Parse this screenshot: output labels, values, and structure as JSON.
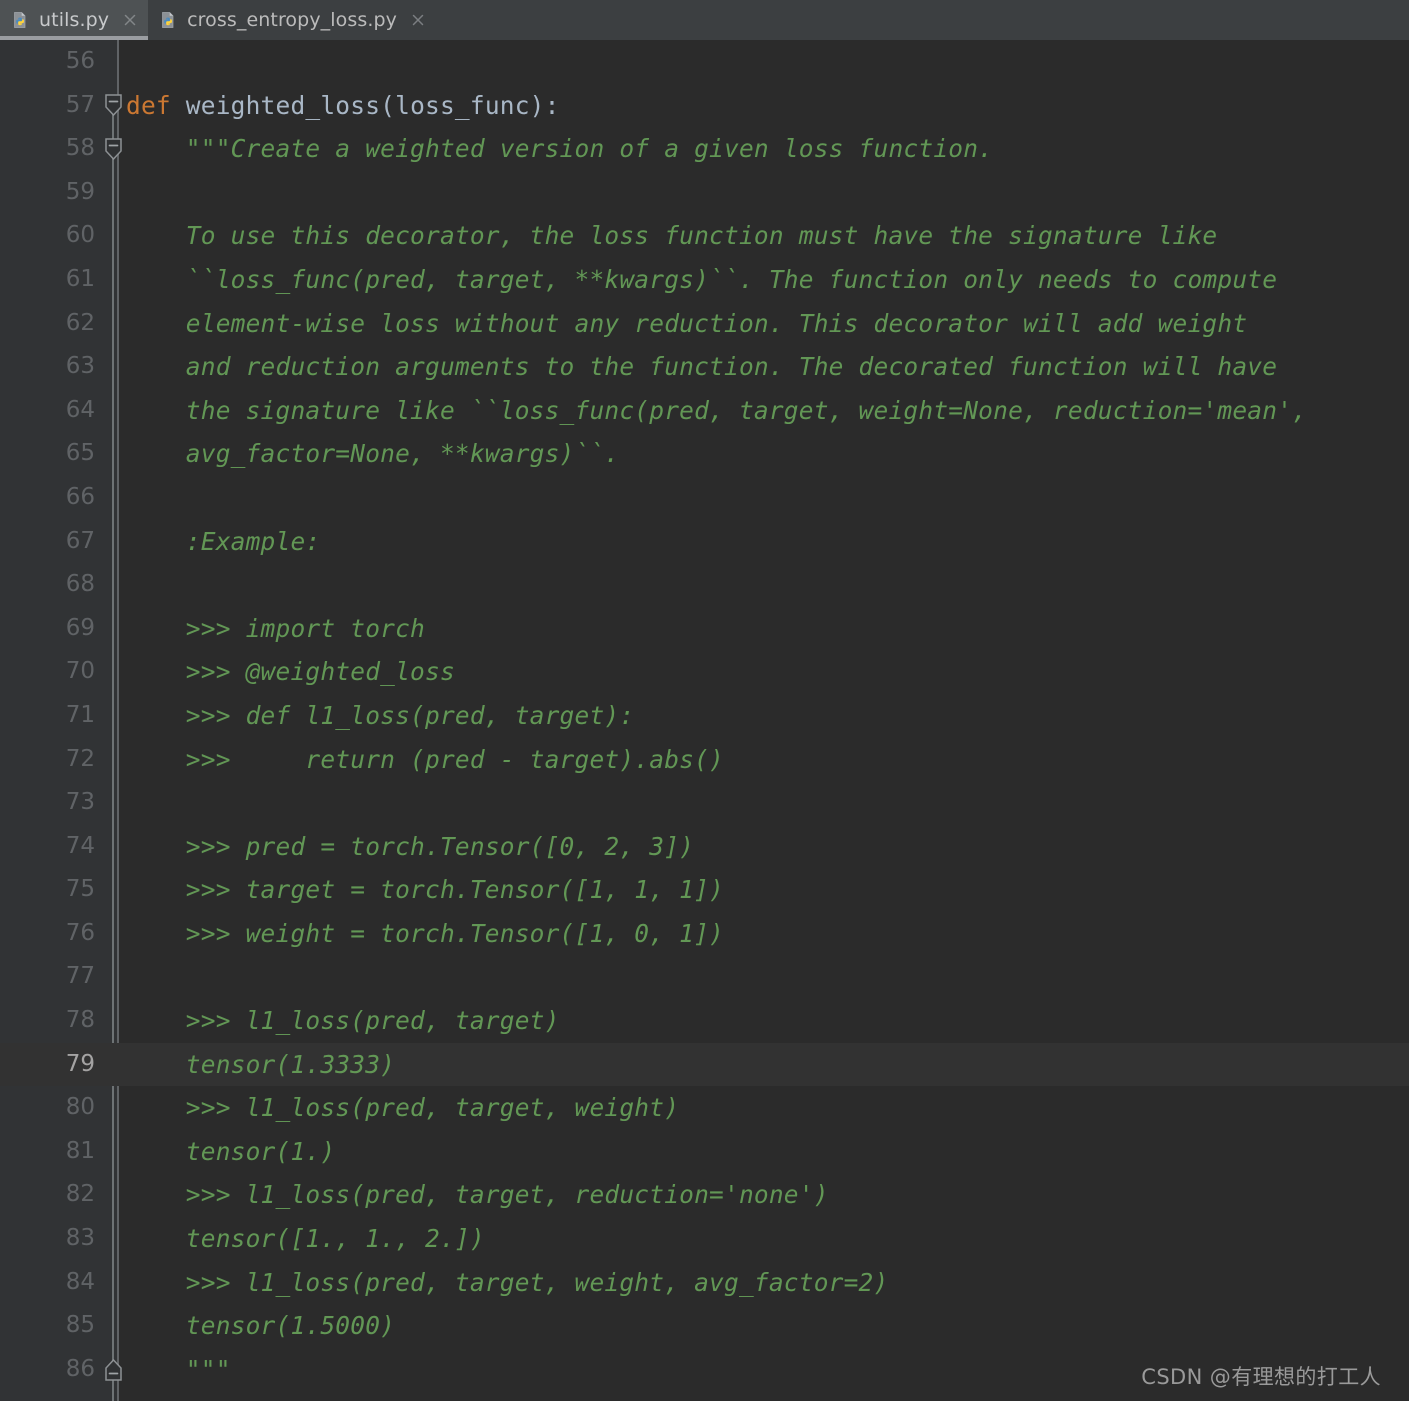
{
  "window": {
    "theme": "darcula",
    "colors": {
      "editor_bg": "#2B2B2B",
      "gutter_bg": "#313335",
      "tabbar_bg": "#3C3F41",
      "active_tab_bg": "#4E5254",
      "caret_line_bg": "#323232",
      "keyword": "#CC7832",
      "identifier": "#A9B7C6",
      "docstring": "#629755",
      "lineno": "#606366",
      "lineno_active": "#A4A3A3"
    }
  },
  "tabs": [
    {
      "label": "utils.py",
      "icon": "python-file-icon",
      "close_icon": "close-icon",
      "active": true
    },
    {
      "label": "cross_entropy_loss.py",
      "icon": "python-file-icon",
      "close_icon": "close-icon",
      "active": false
    }
  ],
  "editor": {
    "caret_line": 79,
    "first_line": 56,
    "last_line": 86,
    "lines": [
      {
        "n": 56,
        "fold": null,
        "segments": []
      },
      {
        "n": 57,
        "fold": "open",
        "segments": [
          {
            "t": "def",
            "c": "kw"
          },
          {
            "t": " weighted_loss(loss_func):",
            "c": "fn"
          }
        ]
      },
      {
        "n": 58,
        "fold": "open",
        "segments": [
          {
            "t": "    \"\"\"Create a weighted version of a given loss function.",
            "c": "doc"
          }
        ]
      },
      {
        "n": 59,
        "fold": null,
        "segments": []
      },
      {
        "n": 60,
        "fold": null,
        "segments": [
          {
            "t": "    To use this decorator, the loss function must have the signature like",
            "c": "doc"
          }
        ]
      },
      {
        "n": 61,
        "fold": null,
        "segments": [
          {
            "t": "    ``loss_func(pred, target, **kwargs)``. The function only needs to compute",
            "c": "doc"
          }
        ]
      },
      {
        "n": 62,
        "fold": null,
        "segments": [
          {
            "t": "    element-wise loss without any reduction. This decorator will add weight",
            "c": "doc"
          }
        ]
      },
      {
        "n": 63,
        "fold": null,
        "segments": [
          {
            "t": "    and reduction arguments to the function. The decorated function will have",
            "c": "doc"
          }
        ]
      },
      {
        "n": 64,
        "fold": null,
        "segments": [
          {
            "t": "    the signature like ``loss_func(pred, target, weight=None, reduction='mean',",
            "c": "doc"
          }
        ]
      },
      {
        "n": 65,
        "fold": null,
        "segments": [
          {
            "t": "    avg_factor=None, **kwargs)``.",
            "c": "doc"
          }
        ]
      },
      {
        "n": 66,
        "fold": null,
        "segments": []
      },
      {
        "n": 67,
        "fold": null,
        "segments": [
          {
            "t": "    :Example:",
            "c": "doc"
          }
        ]
      },
      {
        "n": 68,
        "fold": null,
        "segments": []
      },
      {
        "n": 69,
        "fold": null,
        "segments": [
          {
            "t": "    >>> import torch",
            "c": "doc"
          }
        ]
      },
      {
        "n": 70,
        "fold": null,
        "segments": [
          {
            "t": "    >>> @weighted_loss",
            "c": "doc"
          }
        ]
      },
      {
        "n": 71,
        "fold": null,
        "segments": [
          {
            "t": "    >>> def l1_loss(pred, target):",
            "c": "doc"
          }
        ]
      },
      {
        "n": 72,
        "fold": null,
        "segments": [
          {
            "t": "    >>>     return (pred - target).abs()",
            "c": "doc"
          }
        ]
      },
      {
        "n": 73,
        "fold": null,
        "segments": []
      },
      {
        "n": 74,
        "fold": null,
        "segments": [
          {
            "t": "    >>> pred = torch.Tensor([0, 2, 3])",
            "c": "doc"
          }
        ]
      },
      {
        "n": 75,
        "fold": null,
        "segments": [
          {
            "t": "    >>> target = torch.Tensor([1, 1, 1])",
            "c": "doc"
          }
        ]
      },
      {
        "n": 76,
        "fold": null,
        "segments": [
          {
            "t": "    >>> weight = torch.Tensor([1, 0, 1])",
            "c": "doc"
          }
        ]
      },
      {
        "n": 77,
        "fold": null,
        "segments": []
      },
      {
        "n": 78,
        "fold": null,
        "segments": [
          {
            "t": "    >>> l1_loss(pred, target)",
            "c": "doc"
          }
        ]
      },
      {
        "n": 79,
        "fold": null,
        "segments": [
          {
            "t": "    tensor(1.3333)",
            "c": "doc"
          }
        ]
      },
      {
        "n": 80,
        "fold": null,
        "segments": [
          {
            "t": "    >>> l1_loss(pred, target, weight)",
            "c": "doc"
          }
        ]
      },
      {
        "n": 81,
        "fold": null,
        "segments": [
          {
            "t": "    tensor(1.)",
            "c": "doc"
          }
        ]
      },
      {
        "n": 82,
        "fold": null,
        "segments": [
          {
            "t": "    >>> l1_loss(pred, target, reduction='none')",
            "c": "doc"
          }
        ]
      },
      {
        "n": 83,
        "fold": null,
        "segments": [
          {
            "t": "    tensor([1., 1., 2.])",
            "c": "doc"
          }
        ]
      },
      {
        "n": 84,
        "fold": null,
        "segments": [
          {
            "t": "    >>> l1_loss(pred, target, weight, avg_factor=2)",
            "c": "doc"
          }
        ]
      },
      {
        "n": 85,
        "fold": null,
        "segments": [
          {
            "t": "    tensor(1.5000)",
            "c": "doc"
          }
        ]
      },
      {
        "n": 86,
        "fold": "close",
        "segments": [
          {
            "t": "    \"\"\"",
            "c": "doc"
          }
        ]
      }
    ]
  },
  "watermark": {
    "text": "CSDN @有理想的打工人"
  }
}
